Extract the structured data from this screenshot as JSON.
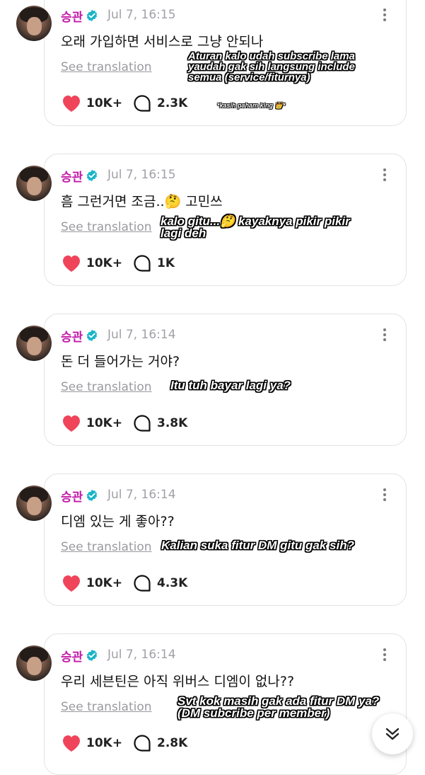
{
  "colors": {
    "username": "#c21aa8",
    "verified": "#19b4c9",
    "heart": "#f0445a",
    "meta": "#a0a0a8"
  },
  "posts": [
    {
      "author": "승관",
      "time": "Jul 7, 16:15",
      "text": "오래 가입하면 서비스로 그냥 안되나",
      "see_translation": "See translation",
      "likes": "10K+",
      "comments": "2.3K",
      "overlay": [
        "Aturan kalo udah subscribe lama",
        "yaudah gak sih langsung include",
        "semua (service/fiturnya)"
      ],
      "overlay_note": "*kasih paham king 👑*"
    },
    {
      "author": "승관",
      "time": "Jul 7, 16:15",
      "text": "흠 그런거면 조금..🤔 고민쓰",
      "see_translation": "See translation",
      "likes": "10K+",
      "comments": "1K",
      "overlay": [
        "kalo gitu...🤔 kayaknya pikir pikir",
        "lagi deh"
      ]
    },
    {
      "author": "승관",
      "time": "Jul 7, 16:14",
      "text": "돈 더 들어가는 거야?",
      "see_translation": "See translation",
      "likes": "10K+",
      "comments": "3.8K",
      "overlay": [
        "Itu tuh bayar lagi ya?"
      ]
    },
    {
      "author": "승관",
      "time": "Jul 7, 16:14",
      "text": "디엠 있는 게 좋아??",
      "see_translation": "See translation",
      "likes": "10K+",
      "comments": "4.3K",
      "overlay": [
        "Kalian suka fitur DM gitu gak sih?"
      ]
    },
    {
      "author": "승관",
      "time": "Jul 7, 16:14",
      "text": "우리 세븐틴은 아직 위버스 디엠이 없나??",
      "see_translation": "See translation",
      "likes": "10K+",
      "comments": "2.8K",
      "overlay": [
        "Svt kok masih gak ada fitur DM ya?",
        "(DM subcribe per member)"
      ]
    }
  ],
  "icons": {
    "verified": "verified-check-icon",
    "more": "more-vertical-icon",
    "like": "heart-icon",
    "comment": "comment-bubble-icon",
    "scroll": "chevron-double-down-icon"
  }
}
